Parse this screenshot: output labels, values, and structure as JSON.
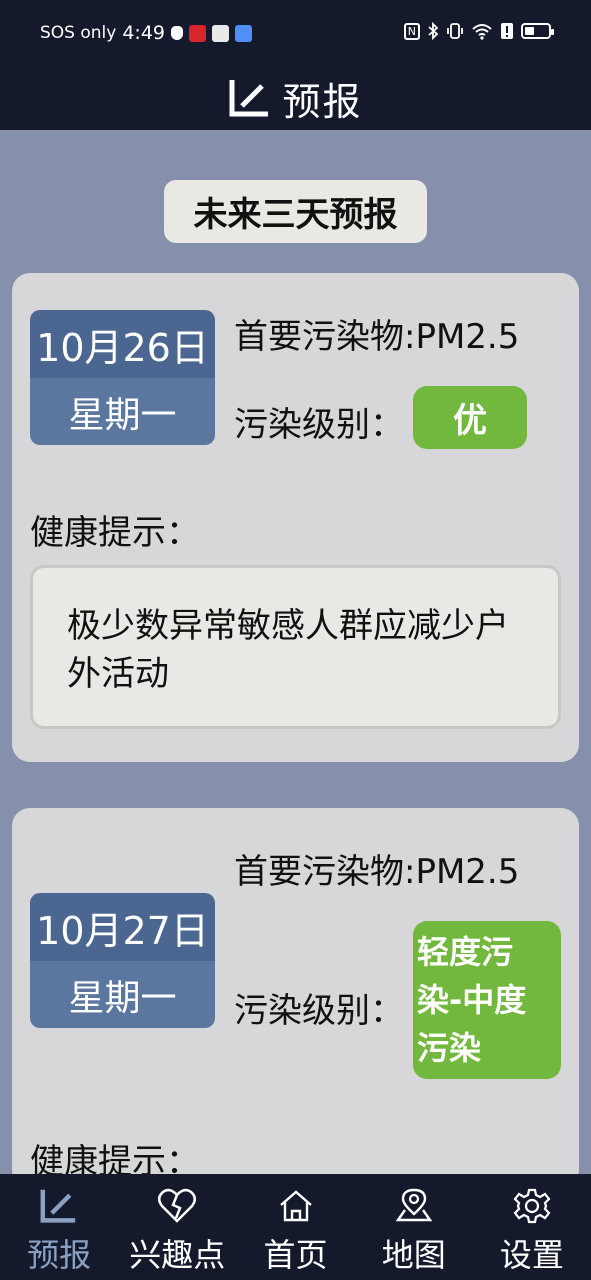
{
  "status_bar": {
    "carrier": "SOS only",
    "time": "4:49",
    "right_text": "N"
  },
  "header": {
    "title": "预报"
  },
  "section_title": "未来三天预报",
  "forecasts": [
    {
      "date": "10月26日",
      "weekday": "星期一",
      "pollutant": "首要污染物:PM2.5",
      "level_label": "污染级别：",
      "level": "优",
      "health_label": "健康提示：",
      "health_tip": "极少数异常敏感人群应减少户外活动"
    },
    {
      "date": "10月27日",
      "weekday": "星期一",
      "pollutant": "首要污染物:PM2.5",
      "level_label": "污染级别：",
      "level": "轻度污染-中度污染",
      "health_label": "健康提示："
    }
  ],
  "nav": {
    "items": [
      {
        "label": "预报",
        "icon": "forecast-icon",
        "active": true
      },
      {
        "label": "兴趣点",
        "icon": "heart-icon"
      },
      {
        "label": "首页",
        "icon": "home-icon"
      },
      {
        "label": "地图",
        "icon": "map-pin-icon"
      },
      {
        "label": "设置",
        "icon": "gear-icon"
      }
    ]
  },
  "colors": {
    "bar_bg": "#141a2c",
    "page_bg": "#8690ad",
    "card_bg": "#d7d6d9",
    "date_top": "#4b6690",
    "date_bottom": "#5c779f",
    "level_green": "#73b83e",
    "nav_active": "#8aa0c2"
  }
}
